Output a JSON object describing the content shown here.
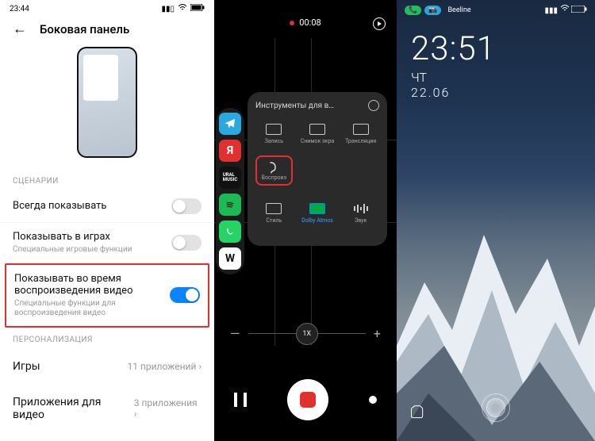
{
  "pane1": {
    "status": {
      "time": "23:44"
    },
    "title": "Боковая панель",
    "section_scenarios": "СЦЕНАРИИ",
    "rows": {
      "always": {
        "label": "Всегда показывать",
        "on": false
      },
      "games": {
        "label": "Показывать в играх",
        "sub": "Специальные игровые функции",
        "on": false
      },
      "video": {
        "label": "Показывать во время воспроизведения видео",
        "sub": "Специальные функции для воспроизведения видео",
        "on": true
      }
    },
    "section_personal": "ПЕРСОНАЛИЗАЦИЯ",
    "links": {
      "games": {
        "label": "Игры",
        "value": "11 приложений"
      },
      "video": {
        "label": "Приложения для видео",
        "value": "3 приложения"
      }
    }
  },
  "pane2": {
    "rec_time": "00:08",
    "panel_title": "Инструменты для в…",
    "tools": {
      "record": "Запись",
      "screenshot": "Снимок экра",
      "cast": "Трансляция",
      "play": "Воспроиз",
      "style": "Стиль",
      "dolby": "Dolby Atmos",
      "sound": "Звук"
    },
    "zoom_label": "1X",
    "zoom_minus": "—",
    "zoom_plus": "+",
    "sidebar_apps": [
      "telegram",
      "yandex",
      "ural-music",
      "spotify",
      "whatsapp",
      "wikipedia"
    ]
  },
  "pane3": {
    "status": {
      "carrier": "Beeline"
    },
    "clock": {
      "time": "23:51",
      "dow": "ЧТ",
      "date": "22.06"
    }
  }
}
